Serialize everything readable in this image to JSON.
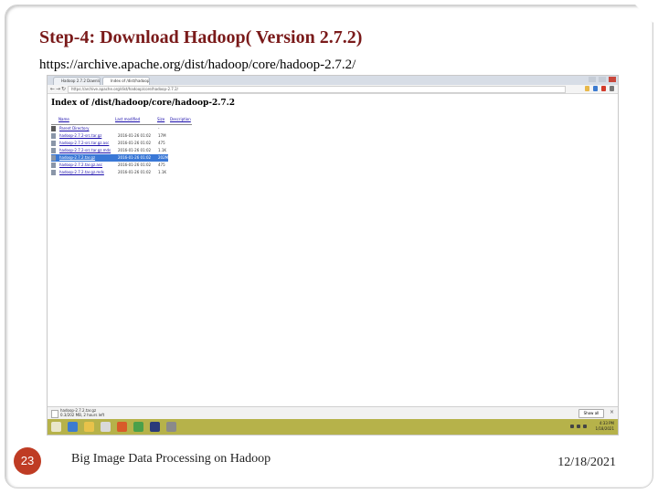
{
  "slide": {
    "title": "Step-4: Download Hadoop( Version 2.7.2)",
    "url": "https://archive.apache.org/dist/hadoop/core/hadoop-2.7.2/",
    "page_number": "23",
    "footer_text": "Big Image Data Processing on Hadoop",
    "date": "12/18/2021"
  },
  "browser": {
    "tabs": [
      "Hadoop 2.7.2 Download",
      "Index of /dist/hadoop"
    ],
    "address": "https://archive.apache.org/dist/hadoop/core/hadoop-2.7.2/"
  },
  "listing": {
    "heading": "Index of /dist/hadoop/core/hadoop-2.7.2",
    "columns": [
      "Name",
      "Last modified",
      "Size",
      "Description"
    ],
    "rows": [
      {
        "name": "Parent Directory",
        "date": "",
        "size": "-"
      },
      {
        "name": "hadoop-2.7.2-src.tar.gz",
        "date": "2016-01-26 01:02",
        "size": "17M"
      },
      {
        "name": "hadoop-2.7.2-src.tar.gz.asc",
        "date": "2016-01-26 01:02",
        "size": "475"
      },
      {
        "name": "hadoop-2.7.2-src.tar.gz.mds",
        "date": "2016-01-26 01:02",
        "size": "1.1K"
      },
      {
        "name": "hadoop-2.7.2.tar.gz",
        "date": "2016-01-26 01:02",
        "size": "202M"
      },
      {
        "name": "hadoop-2.7.2.tar.gz.asc",
        "date": "2016-01-26 01:02",
        "size": "475"
      },
      {
        "name": "hadoop-2.7.2.tar.gz.mds",
        "date": "2016-01-26 01:02",
        "size": "1.1K"
      }
    ],
    "selected_row": 4
  },
  "downloads": {
    "file": "hadoop-2.7.2.tar.gz",
    "status": "0.3/202 MB, 2 hours left",
    "show_all": "Show all"
  },
  "taskbar": {
    "time": "4:33 PM",
    "date": "1/18/2021"
  },
  "colors": {
    "title": "#7a1a1a",
    "badge": "#bf3c24",
    "selection": "#3a78d6",
    "taskbar": "#b6b24a"
  },
  "icons": [
    "back-arrow-icon",
    "forward-arrow-icon",
    "reload-icon",
    "folder-icon",
    "file-icon",
    "star-icon",
    "menu-icon",
    "windows-start-icon"
  ]
}
